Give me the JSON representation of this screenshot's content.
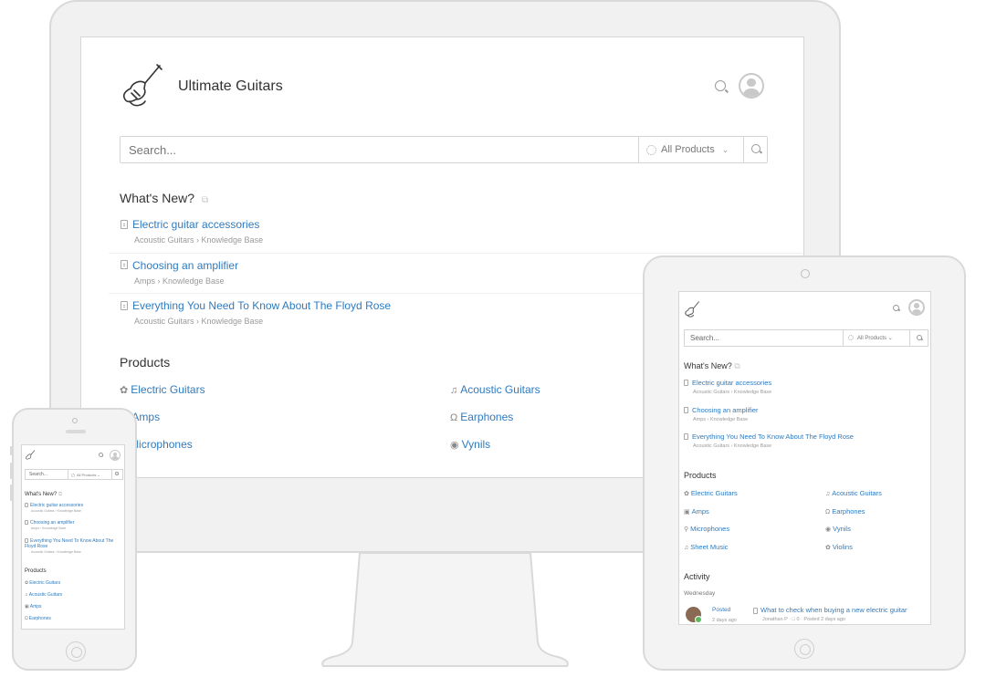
{
  "brand": {
    "site_title": "Ultimate Guitars",
    "logo": "electric-guitar-icon"
  },
  "search": {
    "placeholder": "Search...",
    "filter_label": "All Products",
    "button_icon": "search-icon"
  },
  "whats_new": {
    "heading": "What's New?",
    "items": [
      {
        "title": "Electric guitar accessories",
        "path": "Acoustic Guitars › Knowledge Base"
      },
      {
        "title": "Choosing an amplifier",
        "path": "Amps › Knowledge Base"
      },
      {
        "title": "Everything You Need To Know About The Floyd Rose",
        "path": "Acoustic Guitars › Knowledge Base"
      }
    ]
  },
  "products": {
    "heading": "Products",
    "items": [
      {
        "label": "Electric Guitars",
        "icon": "electric-guitar-icon"
      },
      {
        "label": "Acoustic Guitars",
        "icon": "acoustic-guitar-icon"
      },
      {
        "label": "Amps",
        "icon": "amp-icon"
      },
      {
        "label": "Earphones",
        "icon": "headphones-icon"
      },
      {
        "label": "Microphones",
        "icon": "microphone-icon"
      },
      {
        "label": "Vynils",
        "icon": "vinyl-record-icon"
      },
      {
        "label": "Sheet Music",
        "icon": "music-note-icon"
      },
      {
        "label": "Violins",
        "icon": "violin-icon"
      }
    ]
  },
  "activity": {
    "heading": "Activity",
    "day": "Wednesday",
    "entries": [
      {
        "action": "Posted",
        "when": "2 days ago",
        "title": "What to check when buying a new electric guitar",
        "meta": "Jonathan P · □ 0 · Posted 2 days ago"
      }
    ]
  },
  "colors": {
    "link": "#2e7bbf",
    "muted": "#9a9a9a",
    "device_frame": "#d9d9d9"
  }
}
